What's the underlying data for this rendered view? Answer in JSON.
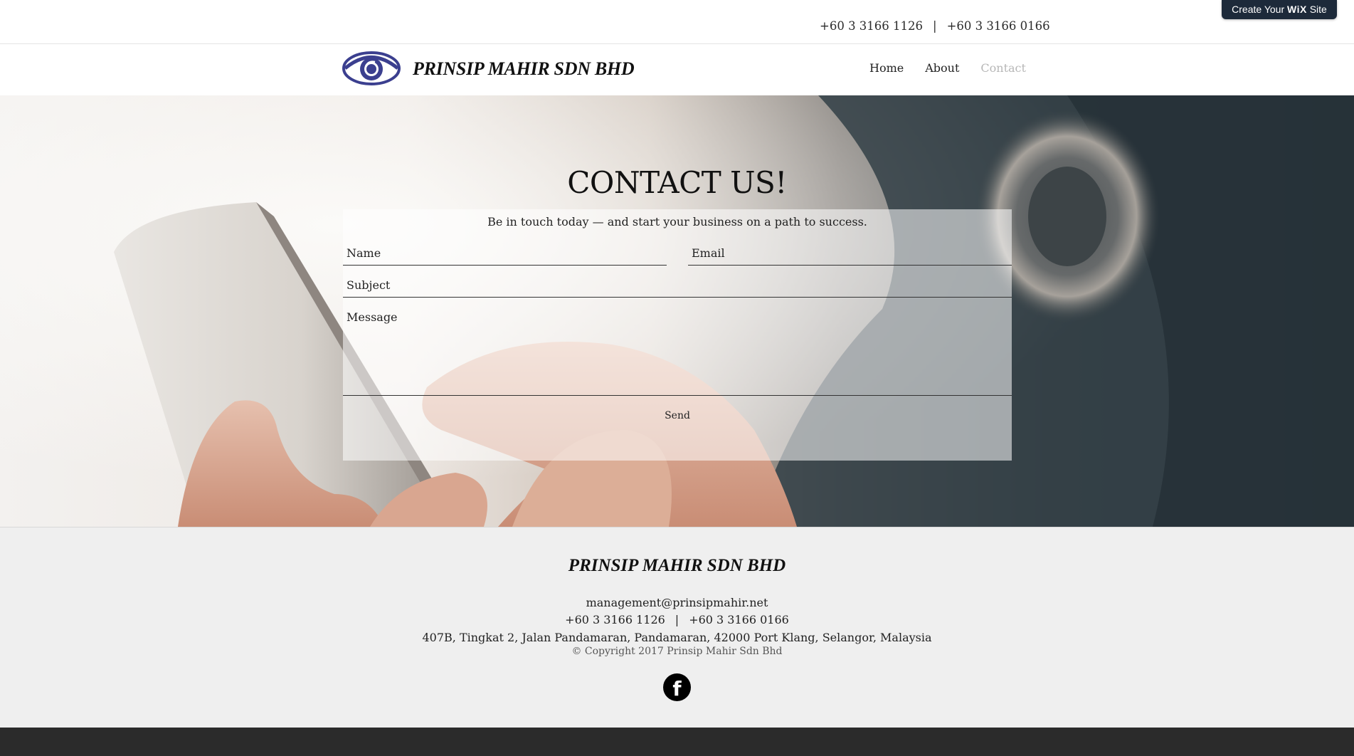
{
  "wix_banner": {
    "prefix": "Create Your",
    "brand": "WiX",
    "suffix": "Site"
  },
  "topbar": {
    "phone1": "+60 3 3166 1126",
    "separator": "|",
    "phone2": "+60 3 3166 0166"
  },
  "header": {
    "brand": "PRINSIP MAHIR SDN BHD",
    "nav": [
      {
        "label": "Home",
        "active": false
      },
      {
        "label": "About",
        "active": false
      },
      {
        "label": "Contact",
        "active": true
      }
    ]
  },
  "hero": {
    "title": "CONTACT US!",
    "subtitle": "Be in touch today — and start your business on a path to success.",
    "form": {
      "name_placeholder": "Name",
      "email_placeholder": "Email",
      "subject_placeholder": "Subject",
      "message_placeholder": "Message",
      "send_label": "Send"
    }
  },
  "footer": {
    "brand": "PRINSIP MAHIR SDN BHD",
    "email": "management@prinsipmahir.net",
    "phone1": "+60 3 3166 1126",
    "separator": "|",
    "phone2": "+60 3 3166 0166",
    "address": "407B, Tingkat 2, Jalan Pandamaran, Pandamaran, 42000 Port Klang, Selangor, Malaysia",
    "copyright": "© Copyright 2017 Prinsip Mahir Sdn Bhd",
    "social_icon": "facebook-icon",
    "social_glyph": "f"
  },
  "colors": {
    "accent_logo": "#3b3f8f",
    "active_nav": "#b7b7b7",
    "footer_bg": "#efefef",
    "bottom_strip": "#2b2b2b",
    "wix_banner_bg": "#1d2a3a"
  }
}
